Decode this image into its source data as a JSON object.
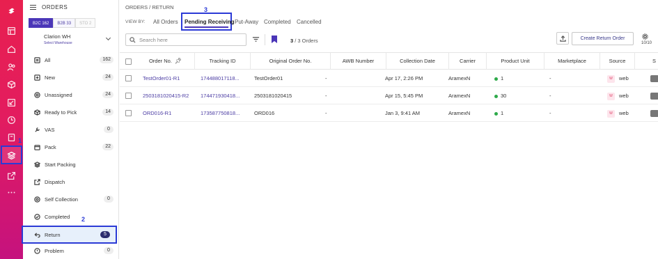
{
  "rail": {
    "annotation": "1",
    "icons": [
      "logo-icon",
      "layout-icon",
      "home-icon",
      "users-icon",
      "box-icon",
      "return-arrow-icon",
      "clock-icon",
      "document-icon",
      "layers-icon",
      "external-link-icon",
      "more-icon"
    ]
  },
  "side": {
    "title": "ORDERS",
    "segments": [
      {
        "label": "B2C",
        "count": "162"
      },
      {
        "label": "B2B",
        "count": "33"
      },
      {
        "label": "STO",
        "count": "2"
      }
    ],
    "warehouse": "Clarion WH",
    "warehouse_sub": "Select Warehouse",
    "items": [
      {
        "label": "All",
        "count": "162",
        "icon": "list-icon"
      },
      {
        "label": "New",
        "count": "24",
        "icon": "plus-icon"
      },
      {
        "label": "Unassigned",
        "count": "24",
        "icon": "target-icon"
      },
      {
        "label": "Ready to Pick",
        "count": "14",
        "icon": "box-icon"
      },
      {
        "label": "VAS",
        "count": "0",
        "icon": "wrench-icon"
      },
      {
        "label": "Pack",
        "count": "22",
        "icon": "package-icon"
      },
      {
        "label": "Start Packing",
        "count": "",
        "icon": "layers-icon"
      },
      {
        "label": "Dispatch",
        "count": "",
        "icon": "external-link-icon"
      },
      {
        "label": "Self Collection",
        "count": "0",
        "icon": "target-icon"
      },
      {
        "label": "Completed",
        "count": "",
        "icon": "check-circle-icon"
      },
      {
        "label": "Return",
        "count": "5",
        "icon": "return-icon"
      },
      {
        "label": "Problem",
        "count": "0",
        "icon": "alert-icon"
      }
    ],
    "annotation": "2"
  },
  "main": {
    "breadcrumb": "ORDERS  /  RETURN",
    "view_by": "VIEW BY:",
    "tabs": [
      "All Orders",
      "Pending Receiving",
      "Put-Away",
      "Completed",
      "Cancelled"
    ],
    "selected_tab": "Pending Receiving",
    "tab_annotation": "3",
    "search_placeholder": "Search here",
    "count_current": "3",
    "count_text": " / 3 Orders",
    "create_button": "Create Return Order",
    "column_count": "10/10",
    "columns": [
      "Order No.",
      "Tracking ID",
      "Original Order No.",
      "AWB Number",
      "Collection Date",
      "Carrier",
      "Product Unit",
      "Marketplace",
      "Source",
      "S"
    ],
    "rows": [
      {
        "order_no": "TestOrder01-R1",
        "tracking_id": "174488017118...",
        "original": "TestOrder01",
        "awb": "-",
        "date": "Apr 17, 2:26 PM",
        "carrier": "AramexN",
        "units": "1",
        "marketplace": "-",
        "source": "web",
        "source_badge": "W"
      },
      {
        "order_no": "2503181020415-R2",
        "tracking_id": "174471930418...",
        "original": "2503181020415",
        "awb": "-",
        "date": "Apr 15, 5:45 PM",
        "carrier": "AramexN",
        "units": "30",
        "marketplace": "-",
        "source": "web",
        "source_badge": "W"
      },
      {
        "order_no": "ORD016-R1",
        "tracking_id": "173587750818...",
        "original": "ORD016",
        "awb": "-",
        "date": "Jan 3, 9:41 AM",
        "carrier": "AramexN",
        "units": "1",
        "marketplace": "-",
        "source": "web",
        "source_badge": "W"
      }
    ]
  },
  "colors": {
    "brand": "#e31c5f",
    "accent": "#4b36b8",
    "annotation": "#2b3ad6",
    "status_dot": "#2eaa4a"
  }
}
